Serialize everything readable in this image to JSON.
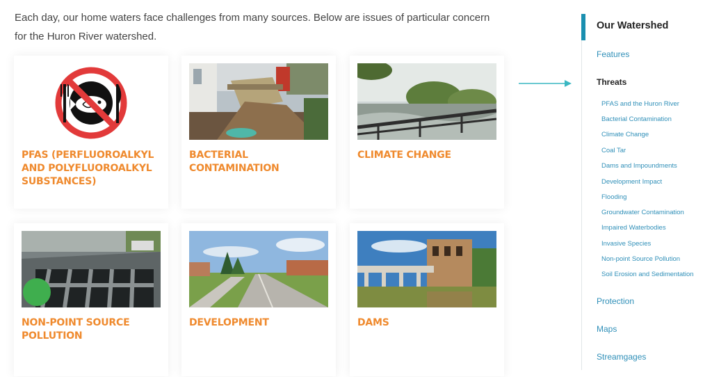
{
  "intro_text": "Each day, our home waters face challenges from many sources. Below are issues of particular concern for the Huron River watershed.",
  "colors": {
    "card_title": "#ef8a2e",
    "link": "#2f8fb8",
    "accent_bar": "#1a8fb0",
    "arrow": "#3ab7c2"
  },
  "cards": [
    {
      "title": "PFAS (PERFLUOROALKYL AND POLYFLUOROALKYL SUBSTANCES)",
      "image": "no-pfas-fish-icon"
    },
    {
      "title": "BACTERIAL CONTAMINATION",
      "image": "excavator-sewer-photo"
    },
    {
      "title": "CLIMATE CHANGE",
      "image": "flooded-river-bridge-photo"
    },
    {
      "title": "NON-POINT SOURCE POLLUTION",
      "image": "storm-drain-photo"
    },
    {
      "title": "DEVELOPMENT",
      "image": "suburban-road-photo"
    },
    {
      "title": "DAMS",
      "image": "dam-building-photo"
    }
  ],
  "sidebar": {
    "title": "Our Watershed",
    "features": "Features",
    "threats": "Threats",
    "threat_links": [
      "PFAS and the Huron River",
      "Bacterial Contamination",
      "Climate Change",
      "Coal Tar",
      "Dams and Impoundments",
      "Development Impact",
      "Flooding",
      "Groundwater Contamination",
      "Impaired Waterbodies",
      "Invasive Species",
      "Non-point Source Pollution",
      "Soil Erosion and Sedimentation"
    ],
    "protection": "Protection",
    "maps": "Maps",
    "streamgages": "Streamgages"
  }
}
